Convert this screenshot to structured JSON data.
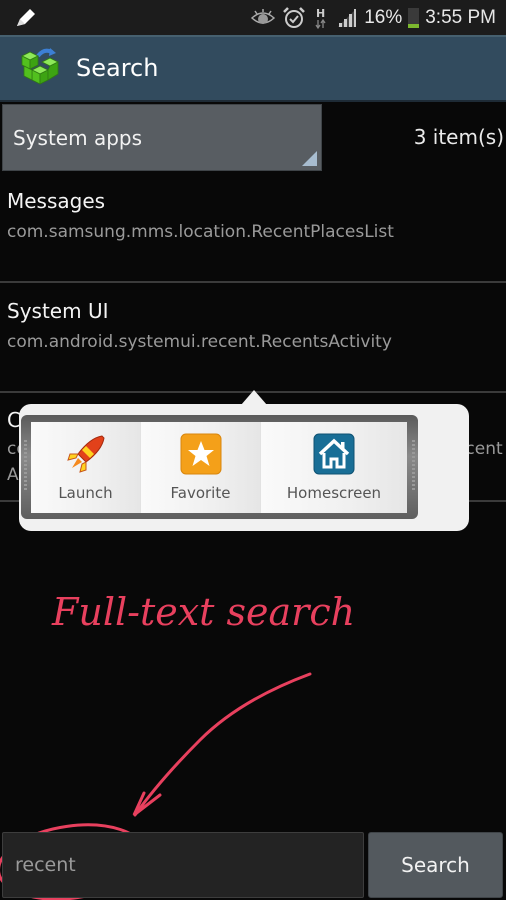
{
  "status_bar": {
    "left_icons": [
      "pen-icon"
    ],
    "right_icons": [
      "eye-icon",
      "alarm-icon",
      "h-data-icon",
      "signal-icon",
      "battery-icon"
    ],
    "battery": "16%",
    "time": "3:55 PM"
  },
  "action_bar": {
    "icon": "registry-cubes-icon",
    "title": "Search"
  },
  "filter": {
    "selected": "System apps",
    "count": "3 item(s)"
  },
  "results": [
    {
      "title": "Messages",
      "subtitle": "com.samsung.mms.location.RecentPlacesList",
      "subtitle2": ""
    },
    {
      "title": "System UI",
      "subtitle": "com.android.systemui.recent.RecentsActivity",
      "subtitle2": ""
    },
    {
      "title": "C",
      "subtitle": "co",
      "subtitle_tail": "ionRecent",
      "subtitle2": "A"
    }
  ],
  "quick_actions": [
    {
      "label": "Launch",
      "icon": "rocket-icon"
    },
    {
      "label": "Favorite",
      "icon": "star-icon"
    },
    {
      "label": "Homescreen",
      "icon": "home-icon"
    }
  ],
  "annotation": {
    "text": "Full-text search",
    "color": "#e8405e"
  },
  "search": {
    "value": "recent",
    "button_label": "Search"
  }
}
